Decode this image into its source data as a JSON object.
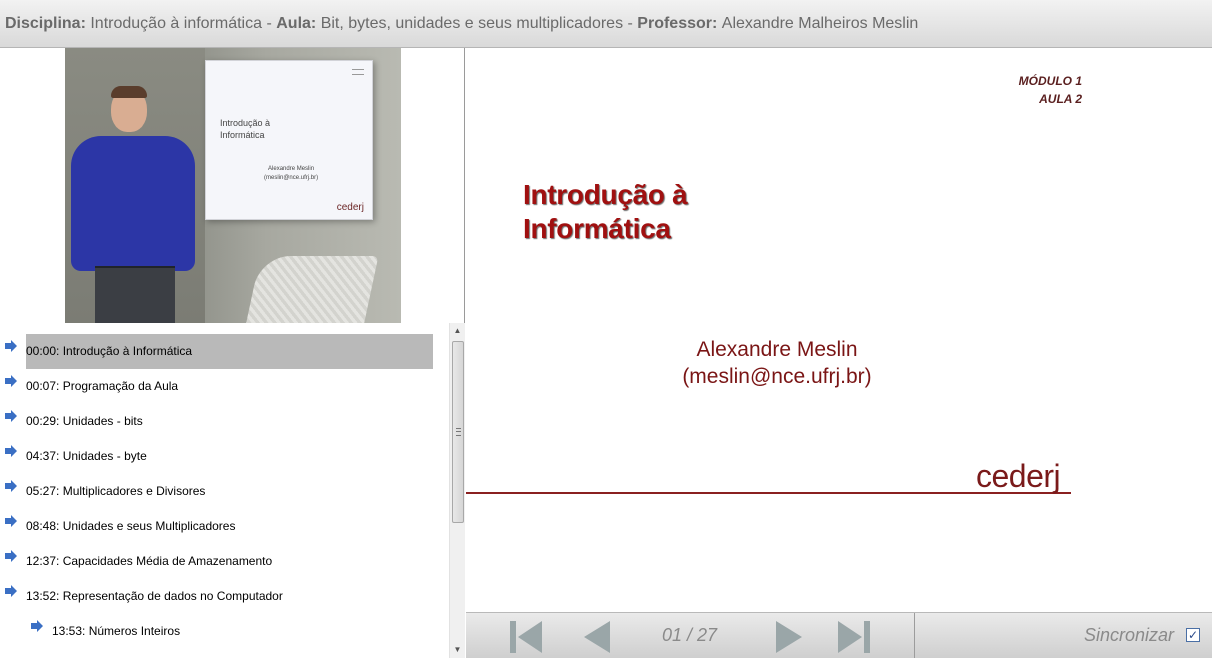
{
  "header": {
    "discipline_label": "Disciplina:",
    "discipline_value": "Introdução à informática",
    "lesson_label": "Aula:",
    "lesson_value": "Bit, bytes, unidades e seus multiplicadores",
    "professor_label": "Professor:",
    "professor_value": "Alexandre Malheiros Meslin",
    "separator": " - "
  },
  "video": {
    "screen_title": "Introdução à Informática",
    "screen_author": "Alexandre Meslin",
    "screen_email": "(meslin@nce.ufrj.br)",
    "screen_logo": "cederj"
  },
  "chapters": [
    {
      "label": "00:00: Introdução à Informática",
      "active": true,
      "level": 0
    },
    {
      "label": "00:07: Programação da Aula",
      "active": false,
      "level": 0
    },
    {
      "label": "00:29: Unidades - bits",
      "active": false,
      "level": 0
    },
    {
      "label": "04:37: Unidades - byte",
      "active": false,
      "level": 0
    },
    {
      "label": "05:27: Multiplicadores e Divisores",
      "active": false,
      "level": 0
    },
    {
      "label": "08:48: Unidades e seus Multiplicadores",
      "active": false,
      "level": 0
    },
    {
      "label": "12:37: Capacidades Média de Amazenamento",
      "active": false,
      "level": 0
    },
    {
      "label": "13:52: Representação de dados no Computador",
      "active": false,
      "level": 0
    },
    {
      "label": "13:53: Números Inteiros",
      "active": false,
      "level": 1
    }
  ],
  "slide": {
    "module": "MÓDULO 1",
    "lesson": "AULA 2",
    "title_line1": "Introdução à",
    "title_line2": "Informática",
    "author": "Alexandre Meslin",
    "email": "(meslin@nce.ufrj.br)",
    "logo": "cederj"
  },
  "navigation": {
    "page_indicator": "01 / 27",
    "sync_label": "Sincronizar",
    "sync_checked": true,
    "sync_check_glyph": "✓",
    "icons": [
      "first-page-icon",
      "previous-page-icon",
      "next-page-icon",
      "last-page-icon"
    ]
  },
  "colors": {
    "arrow_blue": "#3a6fc4",
    "slide_title_red": "#a01010",
    "nav_icon_gray": "#9aa6a8",
    "active_row": "#b9b9b9"
  }
}
